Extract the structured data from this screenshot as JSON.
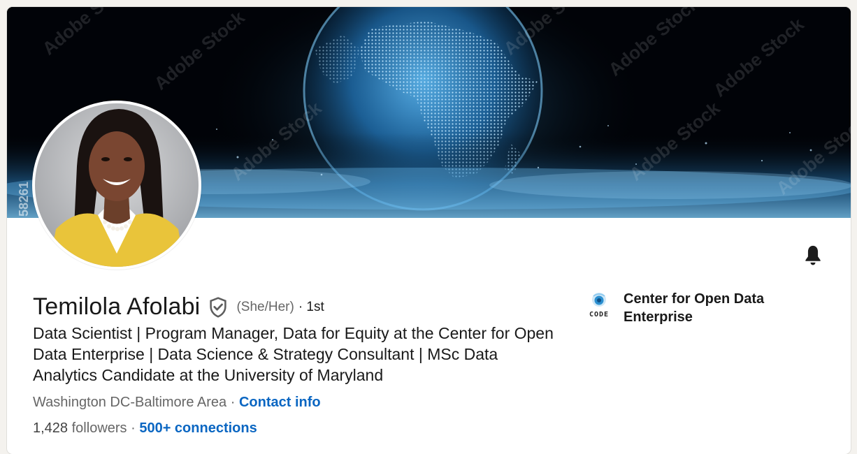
{
  "profile": {
    "name": "Temilola Afolabi",
    "pronouns": "(She/Her)",
    "degree": "· 1st",
    "headline": "Data Scientist | Program Manager, Data for Equity at the Center for Open Data Enterprise | Data Science & Strategy Consultant | MSc Data Analytics Candidate at the University of Maryland",
    "location": "Washington DC-Baltimore Area",
    "location_sep": " · ",
    "contact_info_label": "Contact info",
    "followers_count": "1,428",
    "followers_label": "followers",
    "stats_sep": " · ",
    "connections_label": "500+ connections"
  },
  "banner": {
    "watermark_text": "Adobe Stock",
    "stock_id_fragment": "58261"
  },
  "company": {
    "logo_text": "CODE",
    "name": "Center for Open Data Enterprise"
  },
  "icons": {
    "verified": "shield-check-icon",
    "bell": "bell-icon"
  },
  "colors": {
    "link": "#0a66c2",
    "secondary_text": "#666666",
    "banner_glow": "#4aa8e8"
  }
}
